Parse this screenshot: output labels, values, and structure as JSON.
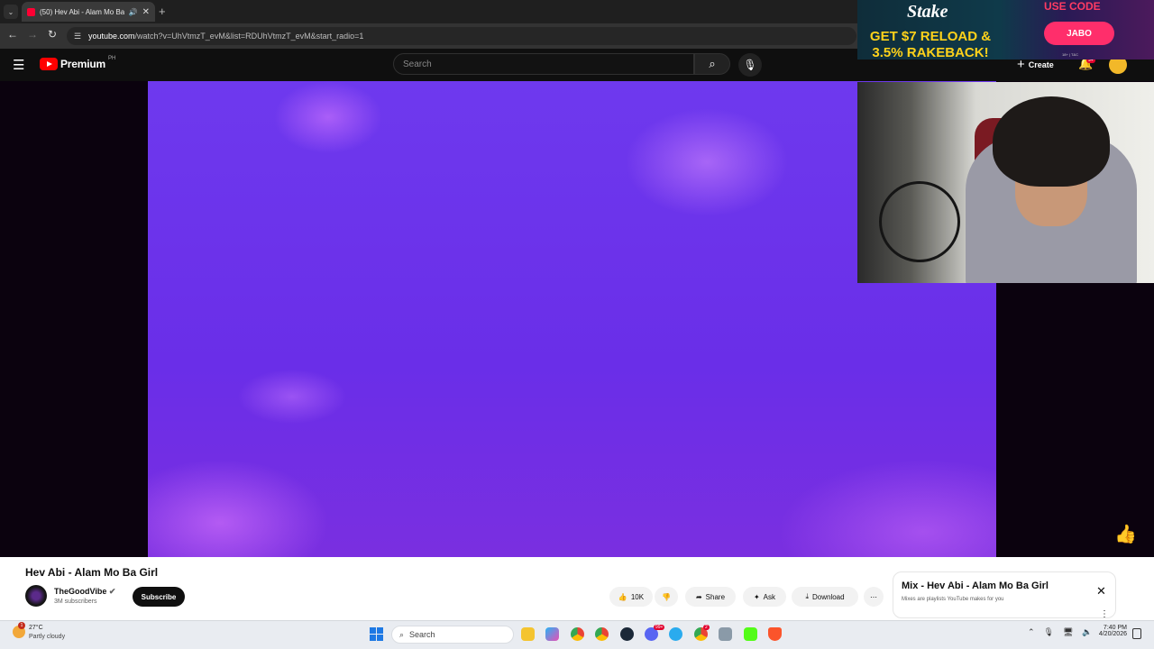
{
  "browser": {
    "tab_title": "(50) Hev Abi - Alam Mo Ba Girl",
    "url_host": "youtube.com",
    "url_path": "/watch?v=UhVtmzT_evM&list=RDUhVtmzT_evM&start_radio=1"
  },
  "youtube": {
    "logo_text": "Premium",
    "country_code": "PH",
    "search_placeholder": "Search",
    "create_label": "Create",
    "notifications_badge": "9+"
  },
  "ad": {
    "brand": "Stake",
    "headline": "GET $7 RELOAD & 3.5% RAKEBACK!",
    "use_code_label": "USE CODE",
    "code": "JABO",
    "fine_print": "18+ | T&C"
  },
  "video": {
    "title": "Hev Abi - Alam Mo Ba Girl",
    "channel_name": "TheGoodVibe",
    "channel_verified": true,
    "subscribers": "3M subscribers",
    "subscribe_label": "Subscribe",
    "likes": "10K",
    "share_label": "Share",
    "ask_label": "Ask",
    "download_label": "Download"
  },
  "mix": {
    "title": "Mix - Hev Abi - Alam Mo Ba Girl",
    "subtitle": "Mixes are playlists YouTube makes for you"
  },
  "taskbar": {
    "temperature": "27°C",
    "condition": "Partly cloudy",
    "weather_badge": "1",
    "search_label": "Search",
    "time": "7:40 PM",
    "date": "4/20/2026",
    "icon_badges": [
      "99+",
      "2"
    ]
  },
  "colors": {
    "youtube_red": "#ff0000",
    "video_purple": "#6e39ee",
    "ad_yellow": "#ffd21a",
    "ad_pink": "#ff2e6b"
  }
}
